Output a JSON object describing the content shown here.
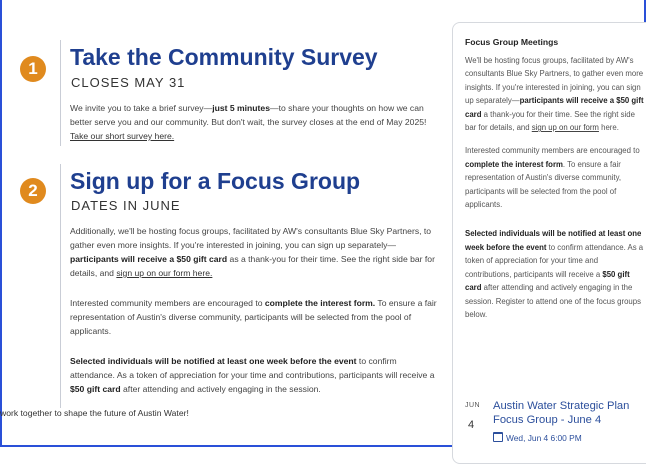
{
  "survey": {
    "number": "1",
    "title": "Take the Community Survey",
    "subtitle": "CLOSES MAY 31",
    "p1": "We invite you to take a brief survey—",
    "p1_bold": "just 5 minutes",
    "p2": "—to share your thoughts on how we can better serve you and our community. But don't wait, the survey closes at the end of May 2025! ",
    "link": "Take our short survey here."
  },
  "focus": {
    "number": "2",
    "title": "Sign up for a Focus Group",
    "subtitle": "DATES IN JUNE",
    "a1": "Additionally, we'll be hosting focus groups, facilitated by AW's consultants Blue Sky Partners, to gather even more insights. If you're interested in joining, you can sign up separately—",
    "a1_bold": "participants will receive a $50 gift card",
    "a2": " as a thank-you for their time. See the right side bar for details, and ",
    "a_link": "sign up on our form here.",
    "b1": "Interested community members are encouraged to ",
    "b1_bold": "complete the interest form.",
    "b2": " To ensure a fair representation of Austin's diverse community, participants will be selected from the pool of applicants.",
    "c1_bold": "Selected individuals will be notified at least one week before the event",
    "c2": " to confirm attendance. As a token of appreciation for your time and contributions, participants will receive a ",
    "c2_bold": "$50 gift card",
    "c3": " after attending and actively engaging in the session."
  },
  "footer": {
    "text": "work together to shape the future of Austin Water!"
  },
  "sidebar": {
    "title": "Focus Group Meetings",
    "p1": "We'll be hosting focus groups, facilitated by AW's consultants Blue Sky Partners, to gather even more insights. If you're interested in joining, you can sign up separately—",
    "p1_bold": "participants will receive a $50 gift card",
    "p1b": " a thank-you for their time. See the right side bar for details, and ",
    "p1_link": "sign up on our form",
    "p1c": " here.",
    "p2": "Interested community members are encouraged to ",
    "p2_bold": "complete the interest form",
    "p2b": ". To ensure a fair representation of Austin's diverse community, participants will be selected from the pool of applicants.",
    "p3_bold": "Selected individuals will be notified at least one week before the event",
    "p3": " to confirm attendance. As a token of appreciation for your time and contributions, participants will receive a ",
    "p3_bold2": "$50 gift card",
    "p3b": " after attending and actively engaging in the session. Register to attend one of the focus groups below.",
    "event": {
      "month": "JUN",
      "day": "4",
      "title_line1": "Austin Water Strategic Plan",
      "title_line2": "Focus Group - June 4",
      "date": "Wed, Jun 4 6:00 PM"
    }
  }
}
